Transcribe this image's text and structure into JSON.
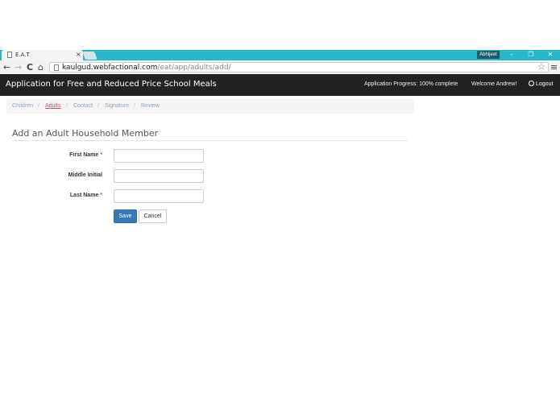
{
  "browser": {
    "tab_title": "E.A.T",
    "tab_close": "×",
    "profile_name": "Abhijeet",
    "window_controls": {
      "minimize": "–",
      "restore": "❐",
      "close": "✕"
    },
    "nav": {
      "back": "←",
      "forward": "→",
      "reload": "C",
      "home": "⌂"
    },
    "url_host": "kaulgud.webfactional.com",
    "url_path": "/eat/app/adults/add/",
    "star": "☆",
    "menu": "≡"
  },
  "navbar": {
    "brand": "Application for Free and Reduced Price School Meals",
    "progress": "Application Progress: 100% complete",
    "welcome": "Welcome Andrew!",
    "logout": "Logout"
  },
  "breadcrumb": {
    "separator": "/",
    "items": [
      {
        "label": "Children",
        "active": false
      },
      {
        "label": "Adults",
        "active": true
      },
      {
        "label": "Contact",
        "active": false
      },
      {
        "label": "Signature",
        "active": false
      },
      {
        "label": "Review",
        "active": false
      }
    ]
  },
  "form": {
    "legend": "Add an Adult Household Member",
    "required_mark": "*",
    "fields": {
      "first_name": {
        "label": "First Name",
        "value": "",
        "required": true
      },
      "middle_initial": {
        "label": "Middle Initial",
        "value": "",
        "required": false
      },
      "last_name": {
        "label": "Last Name",
        "value": "",
        "required": true
      }
    },
    "save_label": "Save",
    "cancel_label": "Cancel"
  }
}
